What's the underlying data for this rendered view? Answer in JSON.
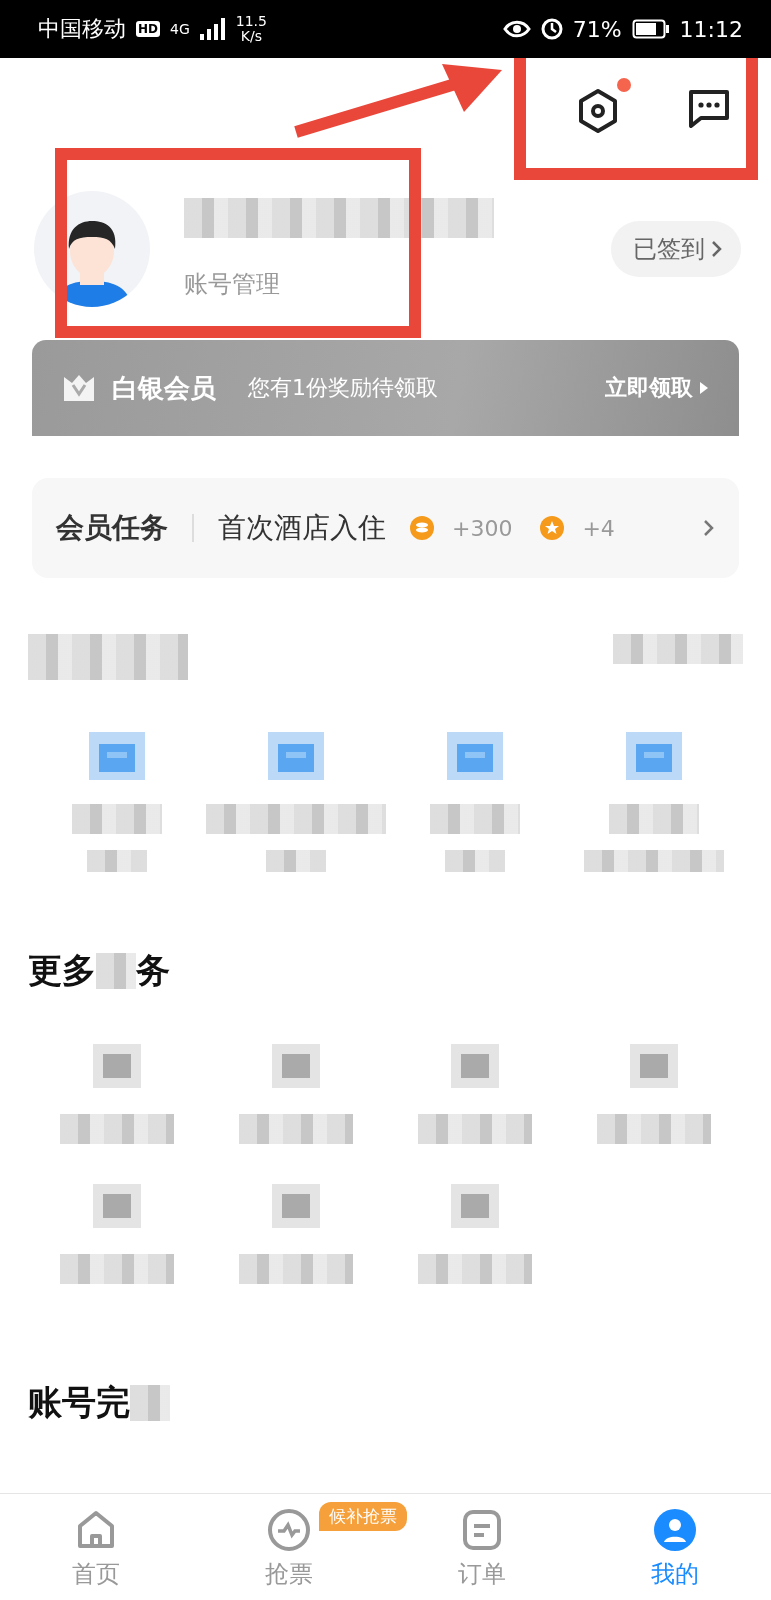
{
  "status_bar": {
    "carrier": "中国移动",
    "hd": "HD",
    "network": "4G",
    "speed": "11.5",
    "speed_unit": "K/s",
    "battery": "71%",
    "time": "11:12"
  },
  "header": {
    "settings_badge": true
  },
  "profile": {
    "account_link": "账号管理",
    "checkin": "已签到"
  },
  "member_banner": {
    "level": "白银会员",
    "message": "您有1份奖励待领取",
    "action": "立即领取"
  },
  "task_card": {
    "title": "会员任务",
    "task": "首次酒店入住",
    "rewards": [
      {
        "kind": "coin",
        "text": "+300"
      },
      {
        "kind": "star",
        "text": "+4"
      }
    ]
  },
  "more_services": {
    "heading_start": "更多",
    "heading_end": "务"
  },
  "account_section": {
    "heading": "账号完"
  },
  "tabs": [
    {
      "label": "首页",
      "kind": "home",
      "selected": false
    },
    {
      "label": "抢票",
      "kind": "pulse",
      "selected": false,
      "badge": "候补抢票"
    },
    {
      "label": "订单",
      "kind": "order",
      "selected": false
    },
    {
      "label": "我的",
      "kind": "me",
      "selected": true
    }
  ]
}
